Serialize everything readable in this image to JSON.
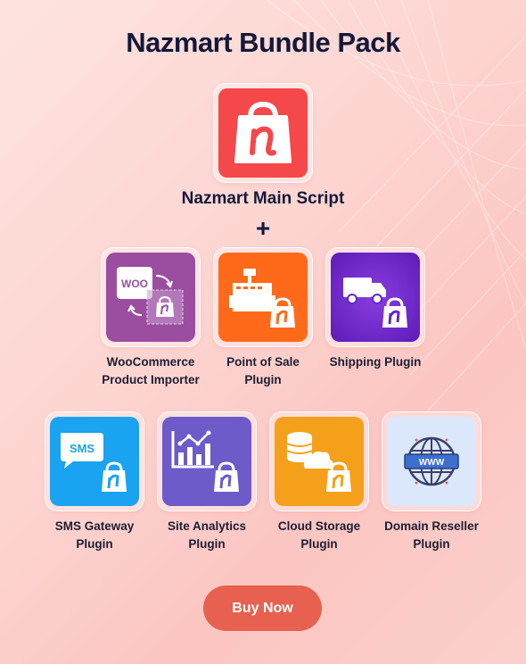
{
  "page": {
    "title": "Nazmart Bundle Pack",
    "plus": "+",
    "buy_label": "Buy Now"
  },
  "main": {
    "label": "Nazmart Main Script",
    "icon": "nazmart-bag-icon",
    "color": "#f5484a"
  },
  "row1": [
    {
      "label_lines": [
        "WooCommerce",
        "Product Importer"
      ],
      "icon": "woocommerce-import-icon",
      "color": "#9b4ea0"
    },
    {
      "label_lines": [
        "Point of Sale",
        "Plugin"
      ],
      "icon": "cash-register-icon",
      "color": "#ff6a1a"
    },
    {
      "label_lines": [
        "Shipping Plugin"
      ],
      "icon": "delivery-truck-icon",
      "color": "#6a22c9"
    }
  ],
  "row2": [
    {
      "label_lines": [
        "SMS Gateway",
        "Plugin"
      ],
      "icon": "sms-bubble-icon",
      "color": "#1aa3f0",
      "badge": "SMS"
    },
    {
      "label_lines": [
        "Site Analytics",
        "Plugin"
      ],
      "icon": "analytics-chart-icon",
      "color": "#6c5bc9"
    },
    {
      "label_lines": [
        "Cloud Storage",
        "Plugin"
      ],
      "icon": "cloud-database-icon",
      "color": "#f5a01a"
    },
    {
      "label_lines": [
        "Domain Reseller",
        "Plugin"
      ],
      "icon": "globe-www-icon",
      "color": "#dbe8fb",
      "badge": "WWW"
    }
  ],
  "woo_text": "WOO"
}
